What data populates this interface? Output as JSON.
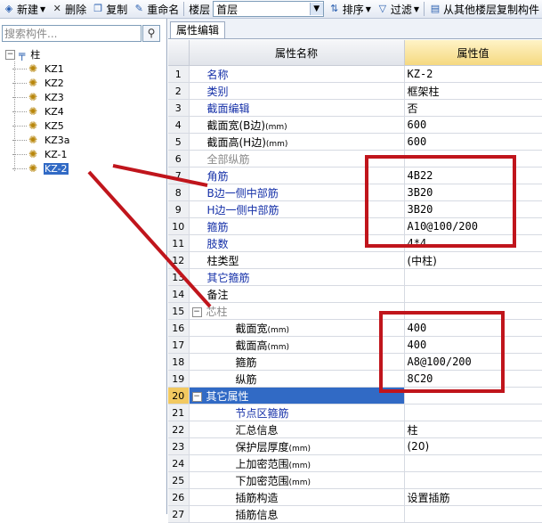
{
  "toolbar": {
    "new": "新建",
    "delete": "删除",
    "copy": "复制",
    "rename": "重命名",
    "floor_label": "楼层",
    "floor_value": "首层",
    "sort": "排序",
    "filter": "过滤",
    "copy_from_floor": "从其他楼层复制构件"
  },
  "sidebar": {
    "search_placeholder": "搜索构件...",
    "root": "柱",
    "items": [
      "KZ1",
      "KZ2",
      "KZ3",
      "KZ4",
      "KZ5",
      "KZ3a",
      "KZ-1",
      "KZ-2"
    ],
    "selected": "KZ-2"
  },
  "tab": {
    "label": "属性编辑"
  },
  "grid": {
    "col_name": "属性名称",
    "col_value": "属性值",
    "rows": [
      {
        "n": "1",
        "name": "名称",
        "value": "KZ-2"
      },
      {
        "n": "2",
        "name": "类别",
        "value": "框架柱"
      },
      {
        "n": "3",
        "name": "截面编辑",
        "value": "否"
      },
      {
        "n": "4",
        "name": "截面宽(B边)",
        "unit": "(mm)",
        "value": "600"
      },
      {
        "n": "5",
        "name": "截面高(H边)",
        "unit": "(mm)",
        "value": "600"
      },
      {
        "n": "6",
        "name": "全部纵筋",
        "value": ""
      },
      {
        "n": "7",
        "name": "角筋",
        "value": "4B22"
      },
      {
        "n": "8",
        "name": "B边一侧中部筋",
        "value": "3B20"
      },
      {
        "n": "9",
        "name": "H边一侧中部筋",
        "value": "3B20"
      },
      {
        "n": "10",
        "name": "箍筋",
        "value": "A10@100/200"
      },
      {
        "n": "11",
        "name": "肢数",
        "value": "4*4"
      },
      {
        "n": "12",
        "name": "柱类型",
        "value": "(中柱)"
      },
      {
        "n": "13",
        "name": "其它箍筋",
        "value": ""
      },
      {
        "n": "14",
        "name": "备注",
        "value": ""
      },
      {
        "n": "15",
        "name": "芯柱",
        "value": ""
      },
      {
        "n": "16",
        "name": "截面宽",
        "unit": "(mm)",
        "value": "400"
      },
      {
        "n": "17",
        "name": "截面高",
        "unit": "(mm)",
        "value": "400"
      },
      {
        "n": "18",
        "name": "箍筋",
        "value": "A8@100/200"
      },
      {
        "n": "19",
        "name": "纵筋",
        "value": "8C20"
      },
      {
        "n": "20",
        "name": "其它属性",
        "value": ""
      },
      {
        "n": "21",
        "name": "节点区箍筋",
        "value": ""
      },
      {
        "n": "22",
        "name": "汇总信息",
        "value": "柱"
      },
      {
        "n": "23",
        "name": "保护层厚度",
        "unit": "(mm)",
        "value": "(20)"
      },
      {
        "n": "24",
        "name": "上加密范围",
        "unit": "(mm)",
        "value": ""
      },
      {
        "n": "25",
        "name": "下加密范围",
        "unit": "(mm)",
        "value": ""
      },
      {
        "n": "26",
        "name": "插筋构造",
        "value": "设置插筋"
      },
      {
        "n": "27",
        "name": "插筋信息",
        "value": ""
      }
    ]
  },
  "annotation_color": "#c0151c"
}
